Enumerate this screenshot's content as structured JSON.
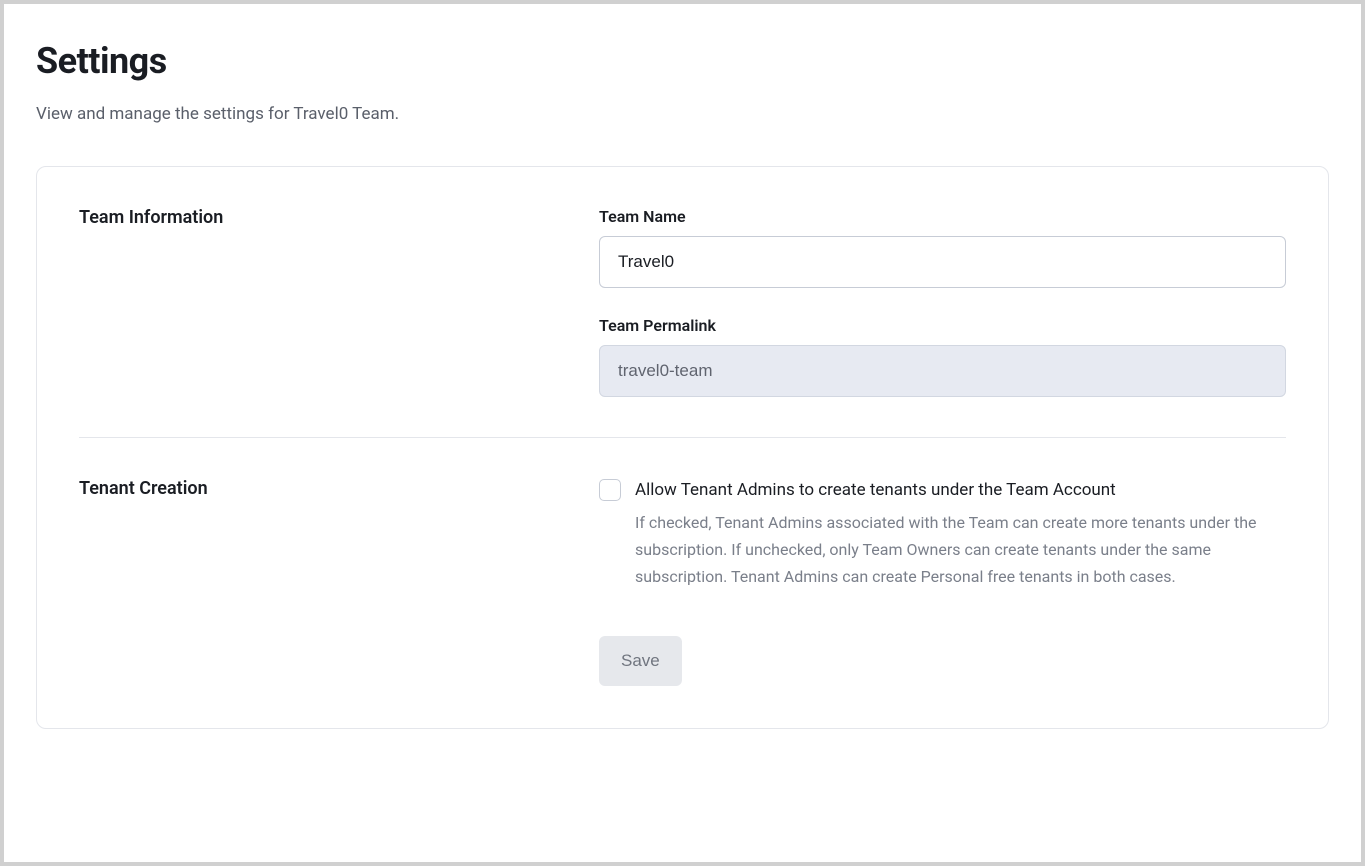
{
  "page": {
    "title": "Settings",
    "subtitle": "View and manage the settings for Travel0 Team."
  },
  "sections": {
    "teamInfo": {
      "heading": "Team Information",
      "fields": {
        "teamName": {
          "label": "Team Name",
          "value": "Travel0"
        },
        "teamPermalink": {
          "label": "Team Permalink",
          "value": "travel0-team"
        }
      }
    },
    "tenantCreation": {
      "heading": "Tenant Creation",
      "checkbox": {
        "label": "Allow Tenant Admins to create tenants under the Team Account",
        "description": "If checked, Tenant Admins associated with the Team can create more tenants under the subscription. If unchecked, only Team Owners can create tenants under the same subscription. Tenant Admins can create Personal free tenants in both cases.",
        "checked": false
      }
    }
  },
  "actions": {
    "save_label": "Save"
  }
}
